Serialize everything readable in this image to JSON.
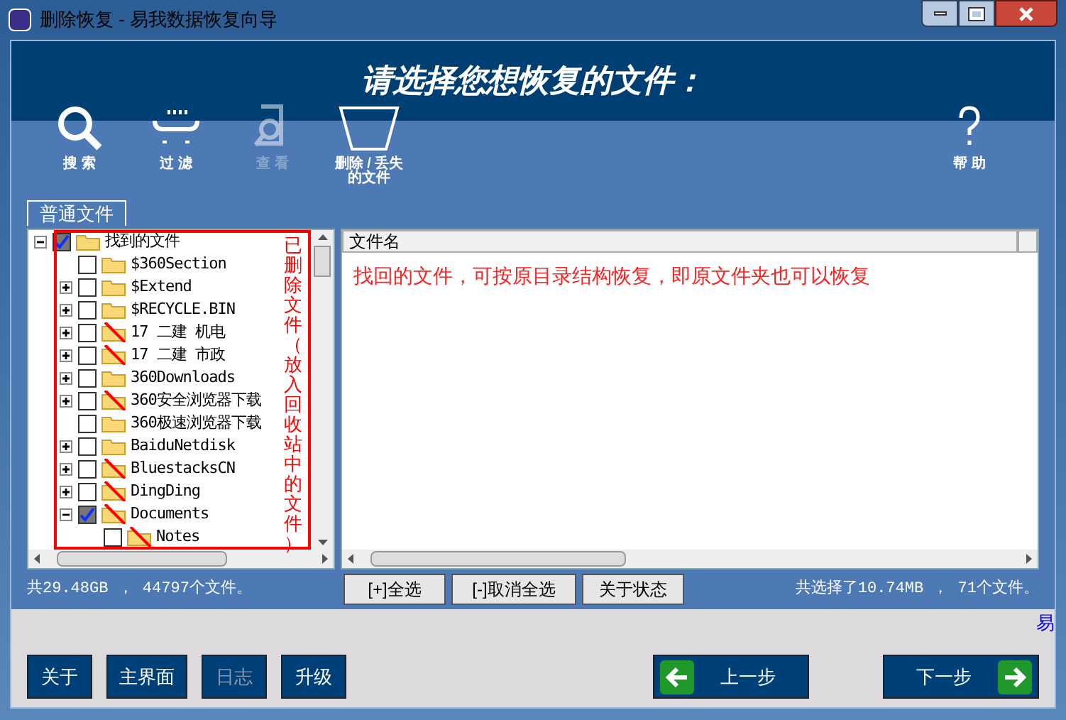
{
  "window": {
    "title": "删除恢复 - 易我数据恢复向导"
  },
  "header": {
    "title": "请选择您想恢复的文件："
  },
  "toolbar": [
    {
      "kind": "search",
      "label": [
        "搜 索"
      ],
      "disabled": false
    },
    {
      "kind": "filter",
      "label": [
        "过 滤"
      ],
      "disabled": false
    },
    {
      "kind": "view",
      "label": [
        "查 看"
      ],
      "disabled": true
    },
    {
      "kind": "deleted",
      "label": [
        "删除 / 丢失",
        "的文件"
      ],
      "disabled": false
    },
    {
      "kind": "help",
      "label": [
        "帮 助"
      ],
      "disabled": false
    }
  ],
  "tabs": [
    {
      "label": "普通文件",
      "selected": true
    }
  ],
  "tree": {
    "label": "找到的文件",
    "checked": true,
    "expandable": true,
    "expanded": true,
    "deleted": false,
    "children": [
      {
        "label": "$360Section",
        "checked": false,
        "expandable": false,
        "deleted": false
      },
      {
        "label": "$Extend",
        "checked": false,
        "expandable": true,
        "expanded": false,
        "deleted": false
      },
      {
        "label": "$RECYCLE.BIN",
        "checked": false,
        "expandable": true,
        "expanded": false,
        "deleted": false
      },
      {
        "label": "17 二建 机电",
        "checked": false,
        "expandable": true,
        "expanded": false,
        "deleted": true
      },
      {
        "label": "17 二建 市政",
        "checked": false,
        "expandable": true,
        "expanded": false,
        "deleted": true
      },
      {
        "label": "360Downloads",
        "checked": false,
        "expandable": true,
        "expanded": false,
        "deleted": false
      },
      {
        "label": "360安全浏览器下载",
        "checked": false,
        "expandable": true,
        "expanded": false,
        "deleted": true
      },
      {
        "label": "360极速浏览器下载",
        "checked": false,
        "expandable": false,
        "deleted": false
      },
      {
        "label": "BaiduNetdisk",
        "checked": false,
        "expandable": true,
        "expanded": false,
        "deleted": false
      },
      {
        "label": "BluestacksCN",
        "checked": false,
        "expandable": true,
        "expanded": false,
        "deleted": true
      },
      {
        "label": "DingDing",
        "checked": false,
        "expandable": true,
        "expanded": false,
        "deleted": true
      },
      {
        "label": "Documents",
        "checked": true,
        "expandable": true,
        "expanded": true,
        "deleted": true,
        "children": [
          {
            "label": "Notes",
            "checked": false,
            "expandable": false,
            "deleted": true
          }
        ]
      }
    ]
  },
  "tree_note": "已删除文件（放入回收站中的文件）",
  "file_list": {
    "columns": [
      "文件名",
      ""
    ],
    "note": "找回的文件，可按原目录结构恢复，即原文件夹也可以恢复"
  },
  "summary_left": "共29.48GB ， 44797个文件。",
  "select_buttons": [
    "[+]全选",
    "[-]取消全选",
    "关于状态"
  ],
  "summary_right": "共选择了10.74MB ， 71个文件。",
  "footer_cut_text": "易",
  "footer_buttons": [
    {
      "label": "关于",
      "disabled": false
    },
    {
      "label": "主界面",
      "disabled": false
    },
    {
      "label": "日志",
      "disabled": true
    },
    {
      "label": "升级",
      "disabled": false
    }
  ],
  "nav_buttons": [
    {
      "kind": "back",
      "label": "上一步"
    },
    {
      "kind": "next",
      "label": "下一步"
    }
  ]
}
